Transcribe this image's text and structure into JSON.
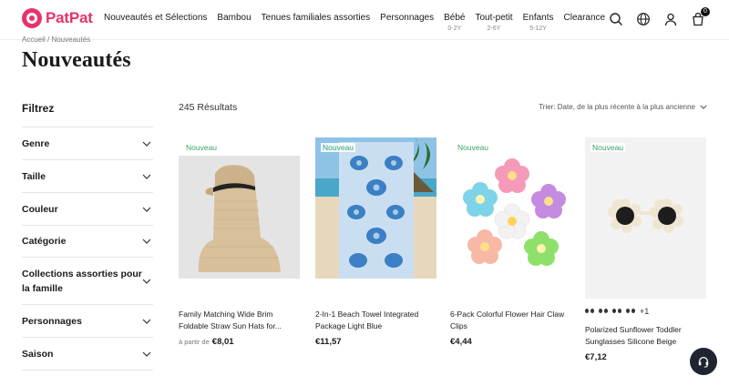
{
  "brand": {
    "name": "PatPat",
    "color": "#e5336b"
  },
  "nav": {
    "items": [
      {
        "label": "Nouveautés et Sélections",
        "sub": ""
      },
      {
        "label": "Bambou",
        "sub": ""
      },
      {
        "label": "Tenues familiales assorties",
        "sub": ""
      },
      {
        "label": "Personnages",
        "sub": ""
      },
      {
        "label": "Bébé",
        "sub": "0-2Y"
      },
      {
        "label": "Tout-petit",
        "sub": "2-6Y"
      },
      {
        "label": "Enfants",
        "sub": "5-12Y"
      },
      {
        "label": "Clearance",
        "sub": ""
      }
    ]
  },
  "header_icons": [
    "search-icon",
    "globe-icon",
    "user-icon",
    "cart-icon"
  ],
  "cart_count": "0",
  "breadcrumb": "Accueil / Nouveautés",
  "page_title": "Nouveautés",
  "sidebar": {
    "title": "Filtrez",
    "filters": [
      {
        "label": "Genre"
      },
      {
        "label": "Taille"
      },
      {
        "label": "Couleur"
      },
      {
        "label": "Catégorie"
      },
      {
        "label": "Collections assorties pour la famille"
      },
      {
        "label": "Personnages"
      },
      {
        "label": "Saison"
      }
    ]
  },
  "results": {
    "count_text": "245 Résultats"
  },
  "sort": {
    "label": "Trier: Date, de la plus récente à la plus ancienne"
  },
  "badge_new": "Nouveau",
  "products": [
    {
      "name": "Family Matching Wide Brim Foldable Straw Sun Hats for...",
      "price_prefix": "à partir de",
      "price": "€8,01"
    },
    {
      "name": "2-In-1 Beach Towel Integrated Package Light Blue",
      "price_prefix": "",
      "price": "€11,57"
    },
    {
      "name": "6-Pack Colorful Flower Hair Claw Clips",
      "price_prefix": "",
      "price": "€4,44"
    },
    {
      "name": "Polarized Sunflower Toddler Sunglasses Silicone Beige",
      "price_prefix": "",
      "price": "€7,12",
      "more_colors": "+1"
    }
  ]
}
